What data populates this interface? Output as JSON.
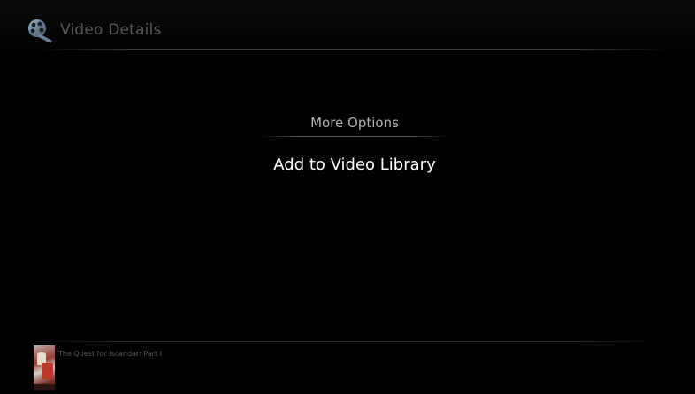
{
  "header": {
    "title": "Video Details",
    "icon": "video-reel-icon"
  },
  "menu": {
    "title": "More Options",
    "items": [
      {
        "label": "Add to Video Library"
      }
    ]
  },
  "footer": {
    "now_playing_title": "The Quest for Iscandar: Part I",
    "thumbnail": "movie-poster-thumbnail"
  },
  "colors": {
    "background": "#000000",
    "header_text": "#55585c",
    "menu_title": "#b3b3b3",
    "menu_item": "#ffffff"
  }
}
